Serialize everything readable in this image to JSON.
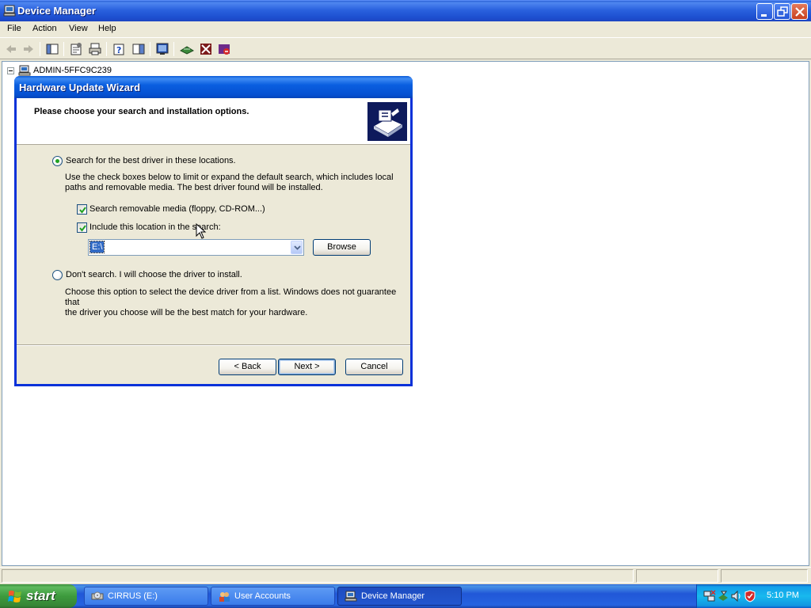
{
  "window": {
    "title": "Device Manager",
    "menu": [
      "File",
      "Action",
      "View",
      "Help"
    ]
  },
  "tree": {
    "root_label": "ADMIN-5FFC9C239"
  },
  "wizard": {
    "title": "Hardware Update Wizard",
    "heading": "Please choose your search and installation options.",
    "option_search": {
      "label": "Search for the best driver in these locations.",
      "selected": true,
      "description_line1": "Use the check boxes below to limit or expand the default search, which includes local",
      "description_line2": "paths and removable media. The best driver found will be installed."
    },
    "checkbox_removable": {
      "label": "Search removable media (floppy, CD-ROM...)",
      "checked": true
    },
    "checkbox_location": {
      "label": "Include this location in the search:",
      "checked": true
    },
    "location_value": "E:\\",
    "browse_label": "Browse",
    "option_manual": {
      "label": "Don't search. I will choose the driver to install.",
      "selected": false,
      "description_line1": "Choose this option to select the device driver from a list.  Windows does not guarantee that",
      "description_line2": "the driver you choose will be the best match for your hardware."
    },
    "back_label": "< Back",
    "next_label": "Next >",
    "cancel_label": "Cancel"
  },
  "taskbar": {
    "start_label": "start",
    "tasks": [
      {
        "label": "CIRRUS (E:)",
        "icon": "cd-drive-icon",
        "active": false
      },
      {
        "label": "User Accounts",
        "icon": "user-accounts-icon",
        "active": false
      },
      {
        "label": "Device Manager",
        "icon": "computer-icon",
        "active": true
      }
    ],
    "tray_icons": [
      "network-icon",
      "safely-remove-hardware-icon",
      "sound-icon",
      "security-shield-icon"
    ],
    "clock": "5:10 PM"
  },
  "colors": {
    "titlebar_blue": "#1d4fd0",
    "start_green": "#3d9a3d",
    "selection_blue": "#316ac5",
    "dialog_face": "#ece9d8"
  }
}
